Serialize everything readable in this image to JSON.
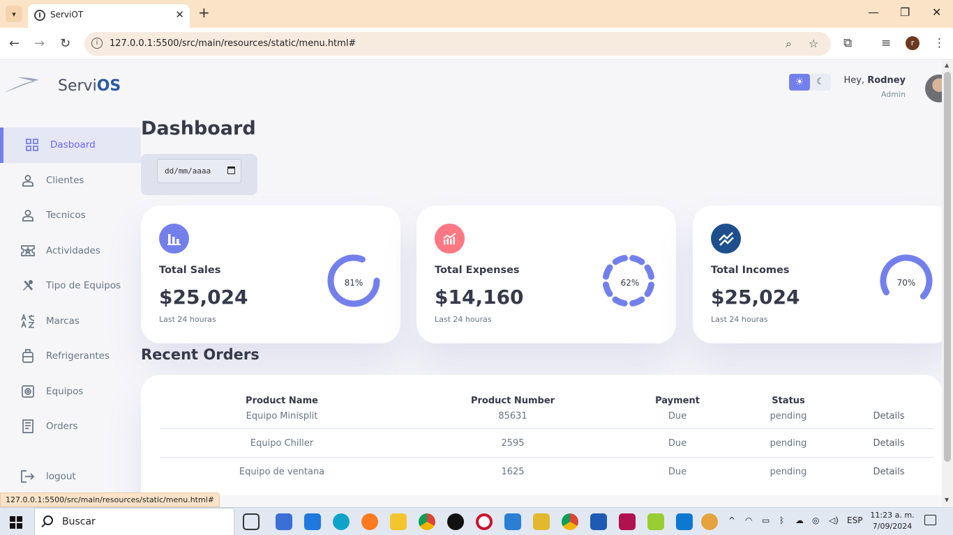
{
  "browser": {
    "tab_title": "ServiOT",
    "url": "127.0.0.1:5500/src/main/resources/static/menu.html#",
    "status_url": "127.0.0.1:5500/src/main/resources/static/menu.html#",
    "profile_initial": "r"
  },
  "app": {
    "brand_prefix": "Servi",
    "brand_suffix": "OS",
    "greeting_prefix": "Hey,",
    "user_name": "Rodney",
    "user_role": "Admin"
  },
  "sidebar": {
    "items": [
      {
        "label": "Dasboard",
        "icon": "grid-icon",
        "active": true
      },
      {
        "label": "Clientes",
        "icon": "person-icon"
      },
      {
        "label": "Tecnicos",
        "icon": "person-icon"
      },
      {
        "label": "Actividades",
        "icon": "ticket-icon"
      },
      {
        "label": "Tipo de Equipos",
        "icon": "tools-icon"
      },
      {
        "label": "Marcas",
        "icon": "translate-icon"
      },
      {
        "label": "Refrigerantes",
        "icon": "luggage-icon"
      },
      {
        "label": "Equipos",
        "icon": "cog-box-icon"
      },
      {
        "label": "Orders",
        "icon": "receipt-icon"
      }
    ],
    "logout": "logout"
  },
  "main": {
    "title": "Dashboard",
    "date_placeholder": "dd/mm/aaaa",
    "cards": [
      {
        "title": "Total Sales",
        "amount": "$25,024",
        "sub": "Last 24 houras",
        "percent_label": "81%",
        "percent": 81,
        "color": "#7380ec",
        "ring_style": "solid"
      },
      {
        "title": "Total Expenses",
        "amount": "$14,160",
        "sub": "Last 24 houras",
        "percent_label": "62%",
        "percent": 62,
        "color": "#ff7782",
        "ring_style": "dashed"
      },
      {
        "title": "Total Incomes",
        "amount": "$25,024",
        "sub": "Last 24 houras",
        "percent_label": "70%",
        "percent": 70,
        "color": "#1e4f8c",
        "ring_style": "solid"
      }
    ],
    "orders_title": "Recent Orders",
    "orders": {
      "headers": [
        "Product Name",
        "Product Number",
        "Payment",
        "Status",
        ""
      ],
      "rows": [
        [
          "Equipo Minisplit",
          "85631",
          "Due",
          "pending",
          "Details"
        ],
        [
          "Equipo Chiller",
          "2595",
          "Due",
          "pending",
          "Details"
        ],
        [
          "Equipo de ventana",
          "1625",
          "Due",
          "pending",
          "Details"
        ]
      ]
    }
  },
  "taskbar": {
    "search_text": "Buscar",
    "lang": "ESP",
    "time": "11:23 a. m.",
    "date": "7/09/2024"
  }
}
